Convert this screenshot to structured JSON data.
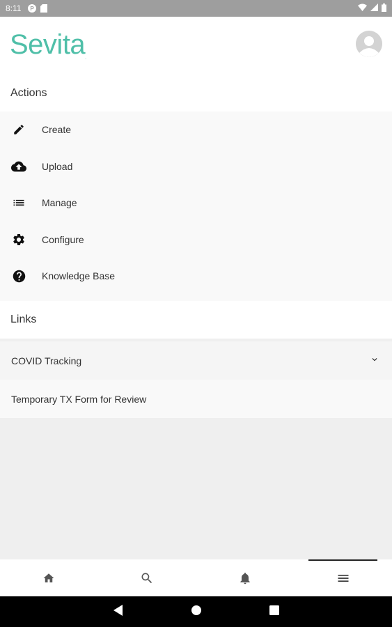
{
  "status_bar": {
    "time": "8:11",
    "icons_left": [
      "p-badge-icon",
      "sd-card-icon"
    ],
    "icons_right": [
      "wifi-icon",
      "signal-icon",
      "battery-icon"
    ]
  },
  "header": {
    "logo_text": "Sevita",
    "logo_mark": ".",
    "brand_color": "#4fbfa8",
    "avatar_icon": "account-circle-icon"
  },
  "actions": {
    "title": "Actions",
    "items": [
      {
        "label": "Create",
        "icon": "pencil-icon"
      },
      {
        "label": "Upload",
        "icon": "cloud-upload-icon"
      },
      {
        "label": "Manage",
        "icon": "list-icon"
      },
      {
        "label": "Configure",
        "icon": "gear-icon"
      },
      {
        "label": "Knowledge Base",
        "icon": "help-circle-icon"
      }
    ]
  },
  "links": {
    "title": "Links",
    "items": [
      {
        "label": "COVID Tracking",
        "icon": "chevron-down-icon"
      },
      {
        "label": "Temporary TX Form for Review"
      }
    ]
  },
  "bottom_nav": {
    "tabs": [
      {
        "icon": "home-icon",
        "active": false
      },
      {
        "icon": "search-icon",
        "active": false
      },
      {
        "icon": "bell-icon",
        "active": false
      },
      {
        "icon": "menu-icon",
        "active": true
      }
    ]
  },
  "system_nav": [
    "back-icon",
    "home-circle-icon",
    "recents-icon"
  ]
}
